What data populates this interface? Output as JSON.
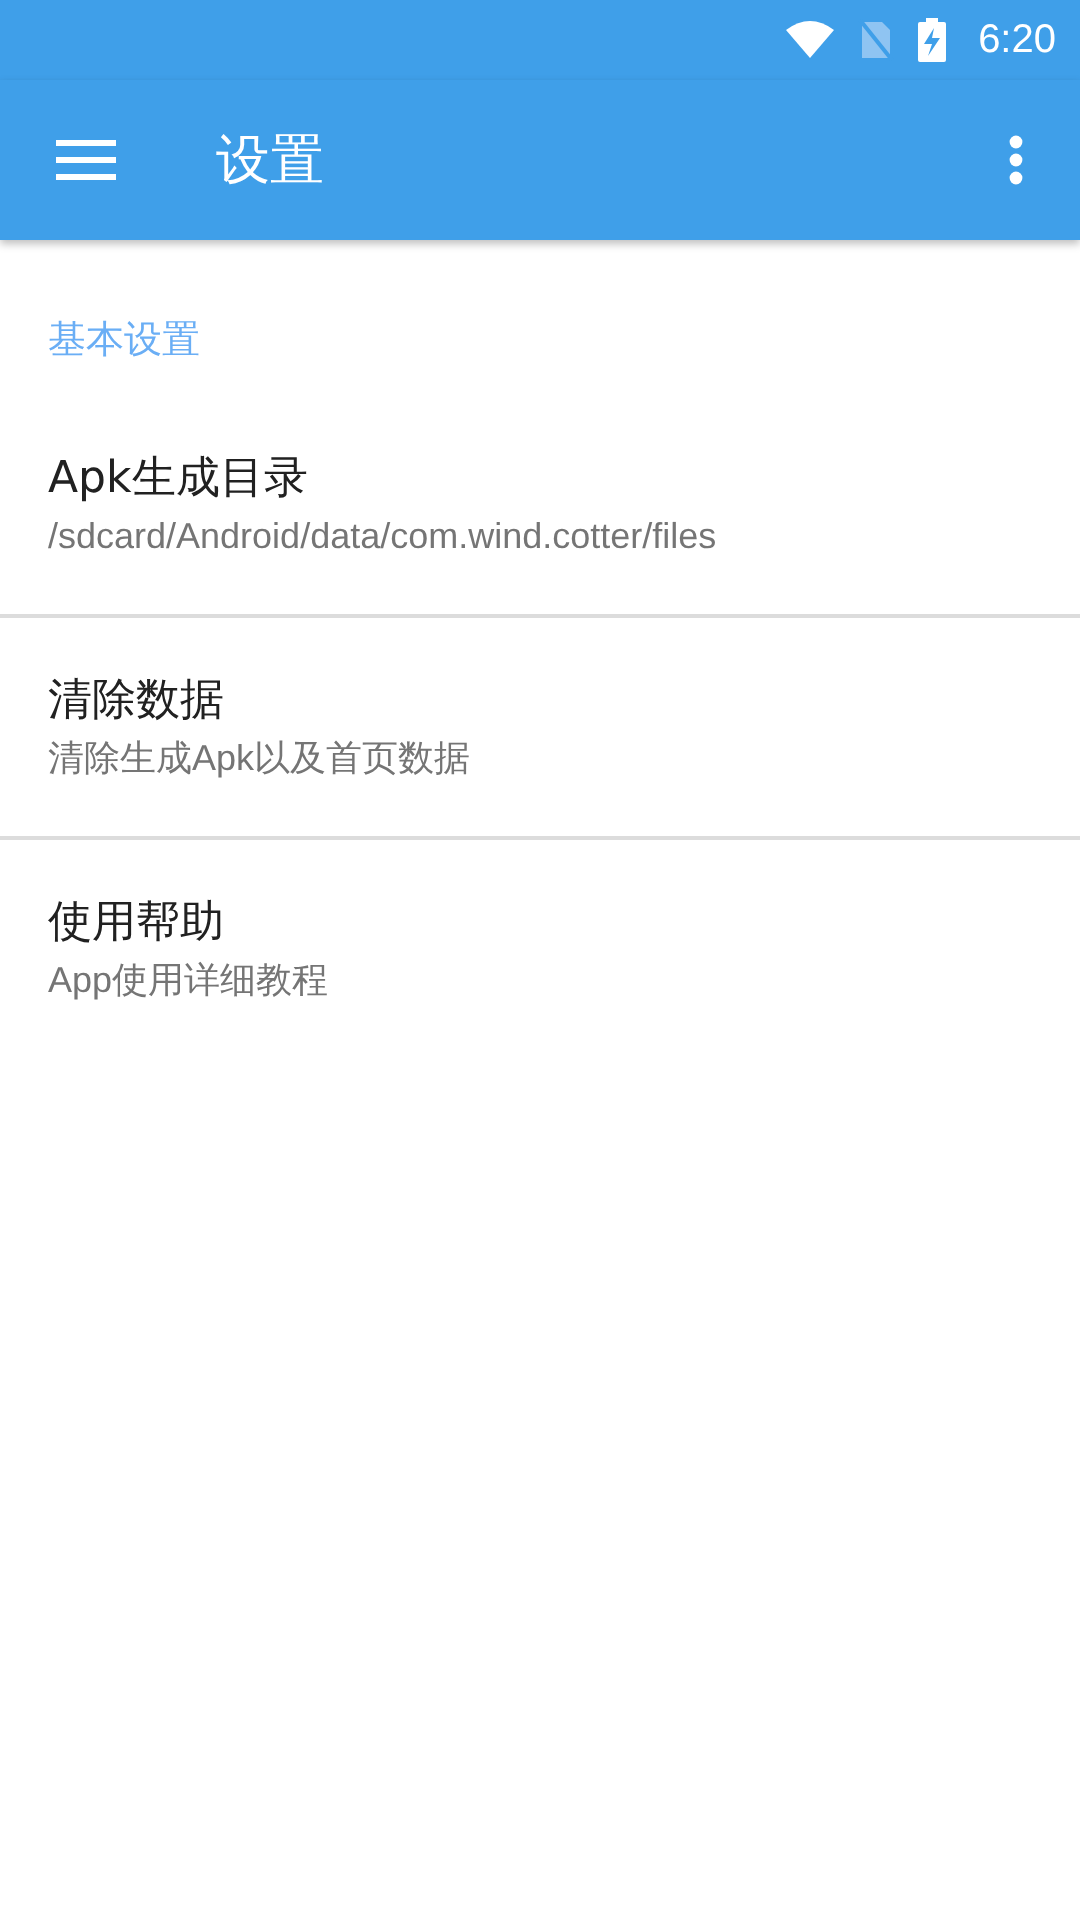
{
  "status_bar": {
    "time": "6:20"
  },
  "toolbar": {
    "title": "设置"
  },
  "section": {
    "title": "基本设置"
  },
  "items": [
    {
      "title": "Apk生成目录",
      "subtitle": "/sdcard/Android/data/com.wind.cotter/files"
    },
    {
      "title": "清除数据",
      "subtitle": "清除生成Apk以及首页数据"
    },
    {
      "title": "使用帮助",
      "subtitle": "App使用详细教程"
    }
  ]
}
